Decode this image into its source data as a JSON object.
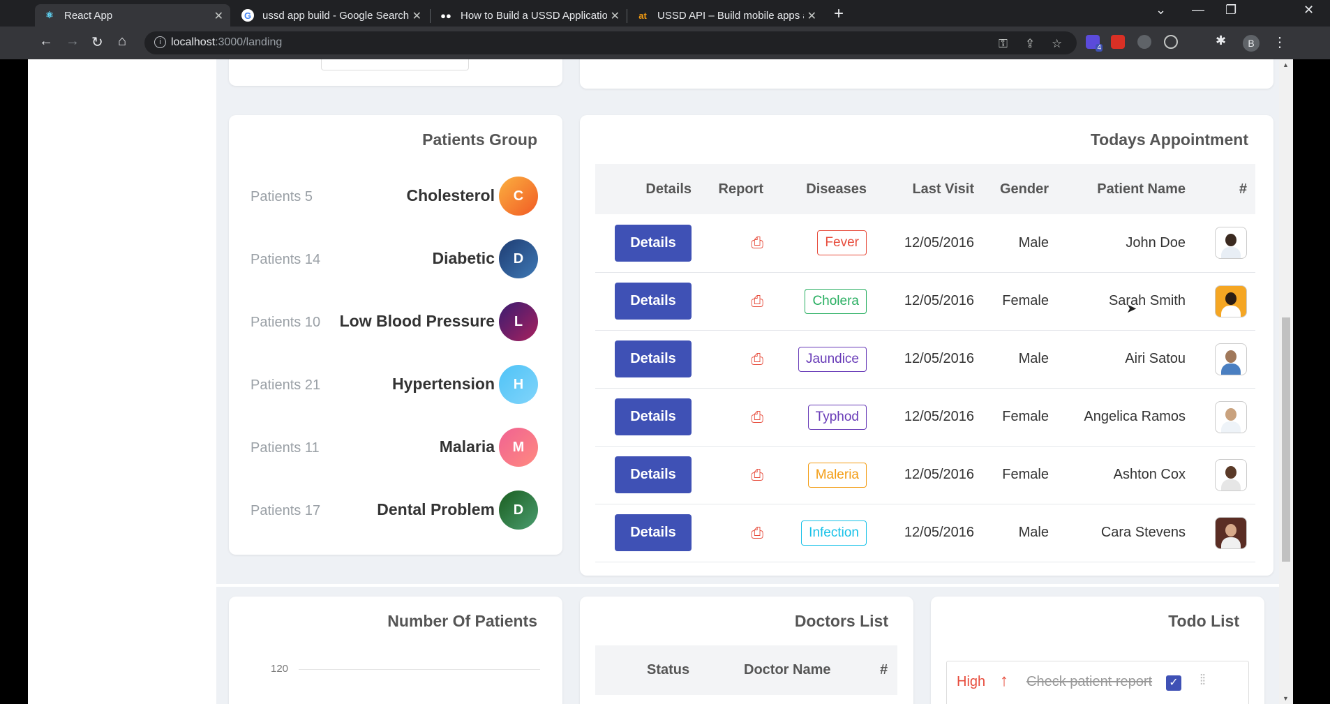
{
  "browser": {
    "tabs": [
      {
        "label": "React App",
        "icon": "react-icon"
      },
      {
        "label": "ussd app build - Google Search",
        "icon": "google-icon"
      },
      {
        "label": "How to Build a USSD Application",
        "icon": "medium-icon"
      },
      {
        "label": "USSD API – Build mobile apps ac",
        "icon": "africastalking-icon"
      }
    ],
    "url_host": "localhost",
    "url_path": ":3000/landing",
    "profile_initial": "B",
    "ext_badge": "4"
  },
  "patients_group": {
    "title": "Patients Group",
    "items": [
      {
        "count": "Patients 5",
        "name": "Cholesterol",
        "initial": "C",
        "color": "#f7931e"
      },
      {
        "count": "Patients 14",
        "name": "Diabetic",
        "initial": "D",
        "color": "#2e5c99"
      },
      {
        "count": "Patients 10",
        "name": "Low Blood Pressure",
        "initial": "L",
        "color": "#7a1f5c"
      },
      {
        "count": "Patients 21",
        "name": "Hypertension",
        "initial": "H",
        "color": "#5ad0f5"
      },
      {
        "count": "Patients 11",
        "name": "Malaria",
        "initial": "M",
        "color": "#f2668b"
      },
      {
        "count": "Patients 17",
        "name": "Dental Problem",
        "initial": "D",
        "color": "#2e7d5b"
      }
    ]
  },
  "appointments": {
    "title": "Todays Appointment",
    "headers": {
      "details": "Details",
      "report": "Report",
      "diseases": "Diseases",
      "last_visit": "Last Visit",
      "gender": "Gender",
      "patient_name": "Patient Name",
      "num": "#"
    },
    "button_label": "Details",
    "rows": [
      {
        "disease": "Fever",
        "disease_color": "#e74c3c",
        "last_visit": "12/05/2016",
        "gender": "Male",
        "name": "John Doe"
      },
      {
        "disease": "Cholera",
        "disease_color": "#27ae60",
        "last_visit": "12/05/2016",
        "gender": "Female",
        "name": "Sarah Smith"
      },
      {
        "disease": "Jaundice",
        "disease_color": "#673ab7",
        "last_visit": "12/05/2016",
        "gender": "Male",
        "name": "Airi Satou"
      },
      {
        "disease": "Typhod",
        "disease_color": "#673ab7",
        "last_visit": "12/05/2016",
        "gender": "Female",
        "name": "Angelica Ramos"
      },
      {
        "disease": "Maleria",
        "disease_color": "#f39c12",
        "last_visit": "12/05/2016",
        "gender": "Female",
        "name": "Ashton Cox"
      },
      {
        "disease": "Infection",
        "disease_color": "#17c1e8",
        "last_visit": "12/05/2016",
        "gender": "Male",
        "name": "Cara Stevens"
      }
    ]
  },
  "number_of_patients": {
    "title": "Number Of Patients",
    "y_tick": "120"
  },
  "doctors_list": {
    "title": "Doctors List",
    "headers": {
      "status": "Status",
      "doctor_name": "Doctor Name",
      "num": "#"
    }
  },
  "todo_list": {
    "title": "Todo List",
    "items": [
      {
        "priority": "High",
        "text": "Check patient report",
        "done": true
      }
    ]
  }
}
